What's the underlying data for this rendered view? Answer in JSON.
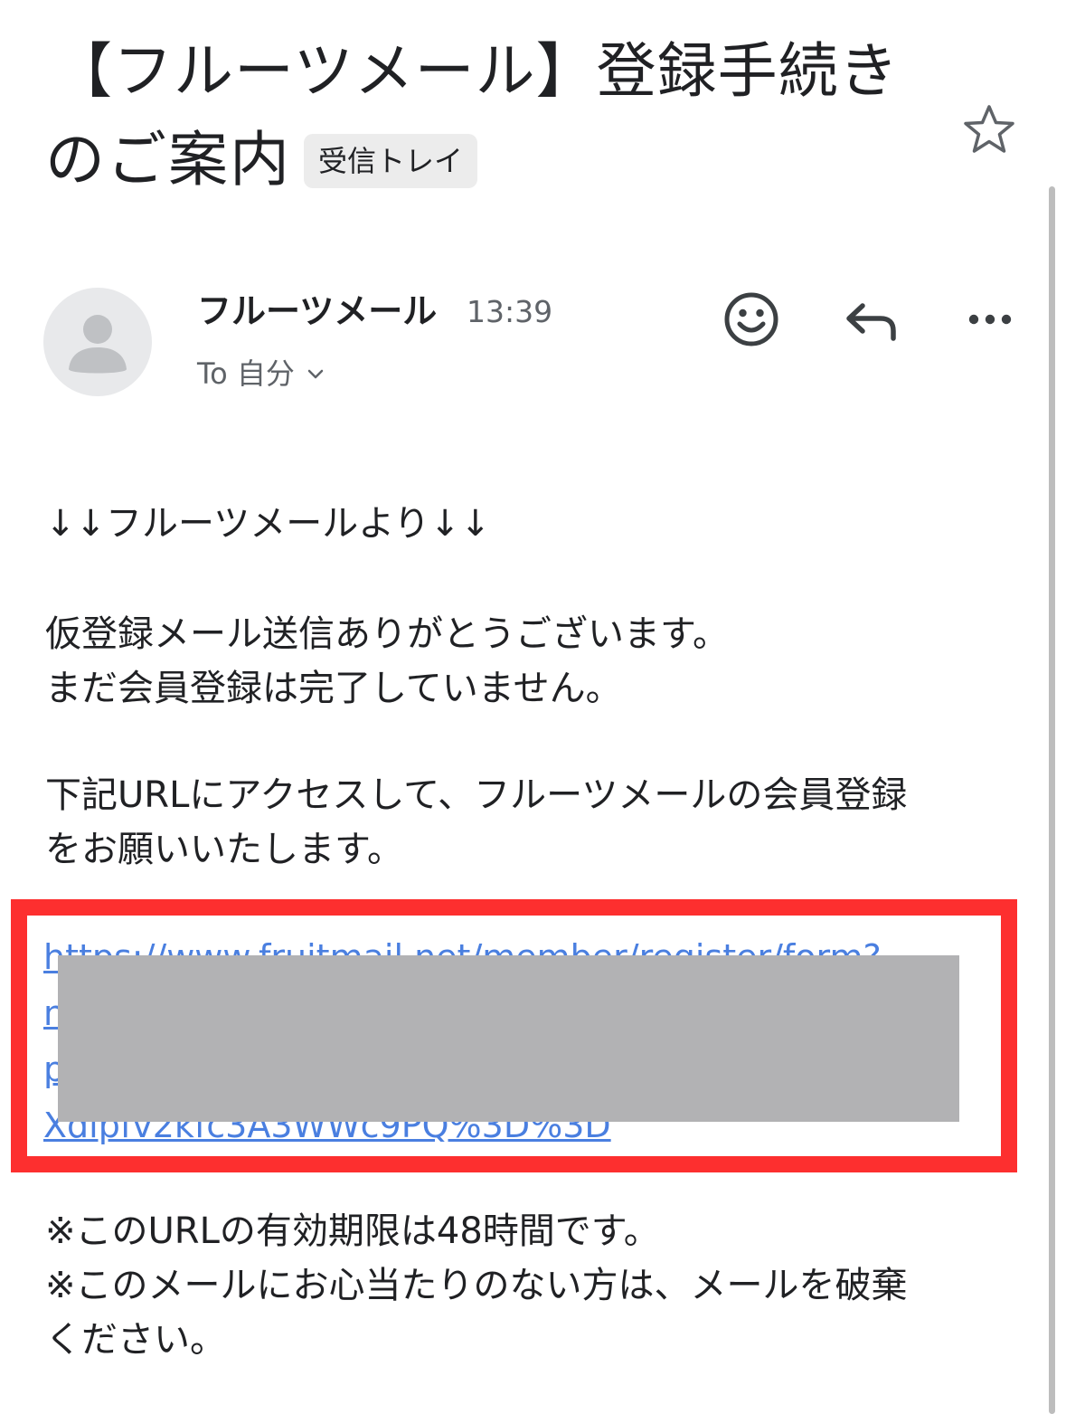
{
  "subject": {
    "line1": "【フルーツメール】登録手続き",
    "line2": "のご案内",
    "label": "受信トレイ"
  },
  "header": {
    "sender_name": "フルーツメール",
    "time": "13:39",
    "recipient": "To 自分"
  },
  "icons": {
    "star": "star-outline-icon",
    "emoji": "smiley-icon",
    "reply": "reply-icon",
    "more": "more-horizontal-icon",
    "avatar": "default-avatar-icon",
    "chevron": "chevron-down-icon"
  },
  "body": {
    "intro": "↓↓フルーツメールより↓↓",
    "p1_line1": "仮登録メール送信ありがとうございます。",
    "p1_line2": "まだ会員登録は完了していません。",
    "p2_line1": "下記URLにアクセスして、フルーツメールの会員登録",
    "p2_line2": "をお願いいたします。",
    "link_line1": "https://www.fruitmail.net/member/register/form?",
    "link_line4": "Xdlpfv2kfc3A3WWc9PQ%3D%3D",
    "note1": "※このURLの有効期限は48時間です。",
    "note2_line1": "※このメールにお心当たりのない方は、メールを破棄",
    "note2_line2": "ください。"
  },
  "colors": {
    "link": "#4a7fe0",
    "highlight_border": "#fd2f2f",
    "redaction": "#b2b2b4",
    "chip_bg": "#ececec"
  }
}
